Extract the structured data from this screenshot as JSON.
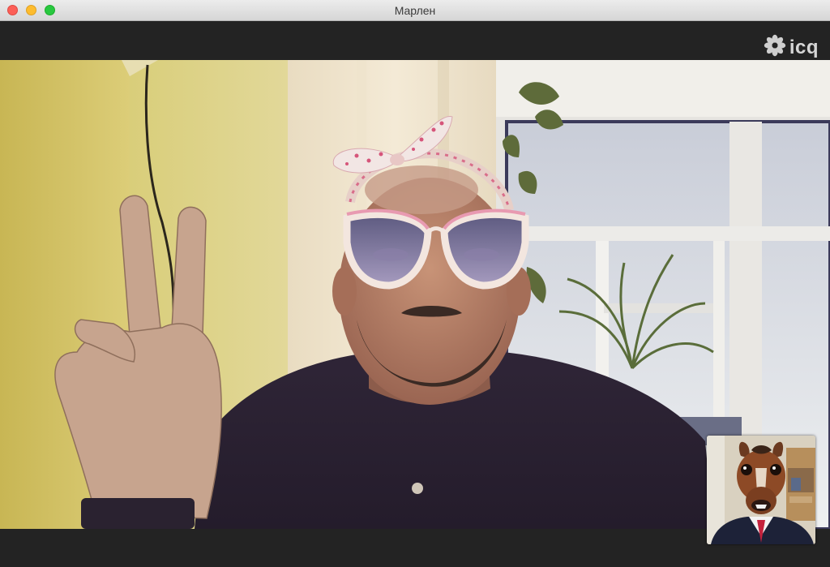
{
  "window": {
    "title": "Марлен",
    "controls": [
      "close",
      "minimize",
      "zoom"
    ]
  },
  "brand": {
    "logo_text": "icq",
    "logo_icon": "icq-flower-icon"
  },
  "call": {
    "remote_video": "remote-participant-video",
    "self_view": "self-camera-preview"
  },
  "colors": {
    "background": "#232323",
    "close": "#fc5f57",
    "minimize": "#fdbc2e",
    "zoom": "#28c840"
  }
}
